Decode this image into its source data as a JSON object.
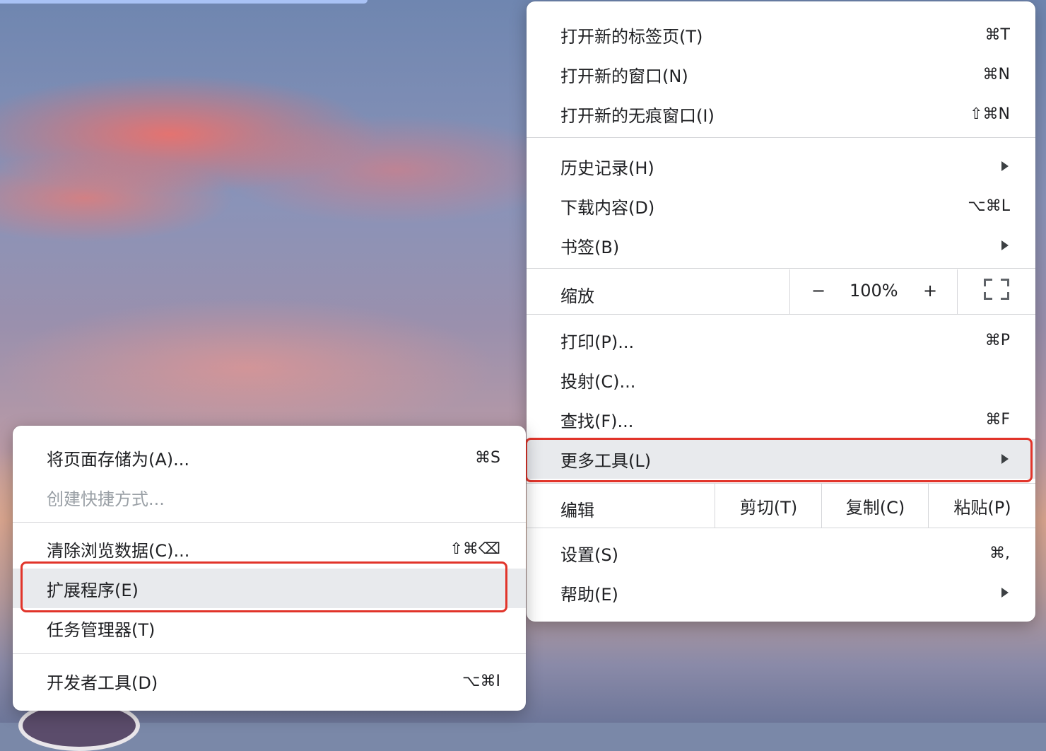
{
  "main_menu": {
    "items": [
      {
        "label": "打开新的标签页(T)",
        "shortcut": "⌘T"
      },
      {
        "label": "打开新的窗口(N)",
        "shortcut": "⌘N"
      },
      {
        "label": "打开新的无痕窗口(I)",
        "shortcut": "⇧⌘N"
      },
      {
        "label": "历史记录(H)",
        "shortcut": ""
      },
      {
        "label": "下载内容(D)",
        "shortcut": "⌥⌘L"
      },
      {
        "label": "书签(B)",
        "shortcut": ""
      },
      {
        "label": "打印(P)...",
        "shortcut": "⌘P"
      },
      {
        "label": "投射(C)...",
        "shortcut": ""
      },
      {
        "label": "查找(F)...",
        "shortcut": "⌘F"
      },
      {
        "label": "更多工具(L)",
        "shortcut": ""
      },
      {
        "label": "设置(S)",
        "shortcut": "⌘,"
      },
      {
        "label": "帮助(E)",
        "shortcut": ""
      }
    ],
    "zoom": {
      "label": "缩放",
      "minus": "−",
      "value": "100%",
      "plus": "+"
    },
    "edit": {
      "label": "编辑",
      "cut": "剪切(T)",
      "copy": "复制(C)",
      "paste": "粘贴(P)"
    }
  },
  "sub_menu": {
    "items": [
      {
        "label": "将页面存储为(A)...",
        "shortcut": "⌘S"
      },
      {
        "label": "创建快捷方式...",
        "shortcut": ""
      },
      {
        "label": "清除浏览数据(C)...",
        "shortcut": "⇧⌘⌫"
      },
      {
        "label": "扩展程序(E)",
        "shortcut": ""
      },
      {
        "label": "任务管理器(T)",
        "shortcut": ""
      },
      {
        "label": "开发者工具(D)",
        "shortcut": "⌥⌘I"
      }
    ]
  },
  "colors": {
    "highlight_outline": "#e1342a",
    "hover": "#e8eaed"
  }
}
